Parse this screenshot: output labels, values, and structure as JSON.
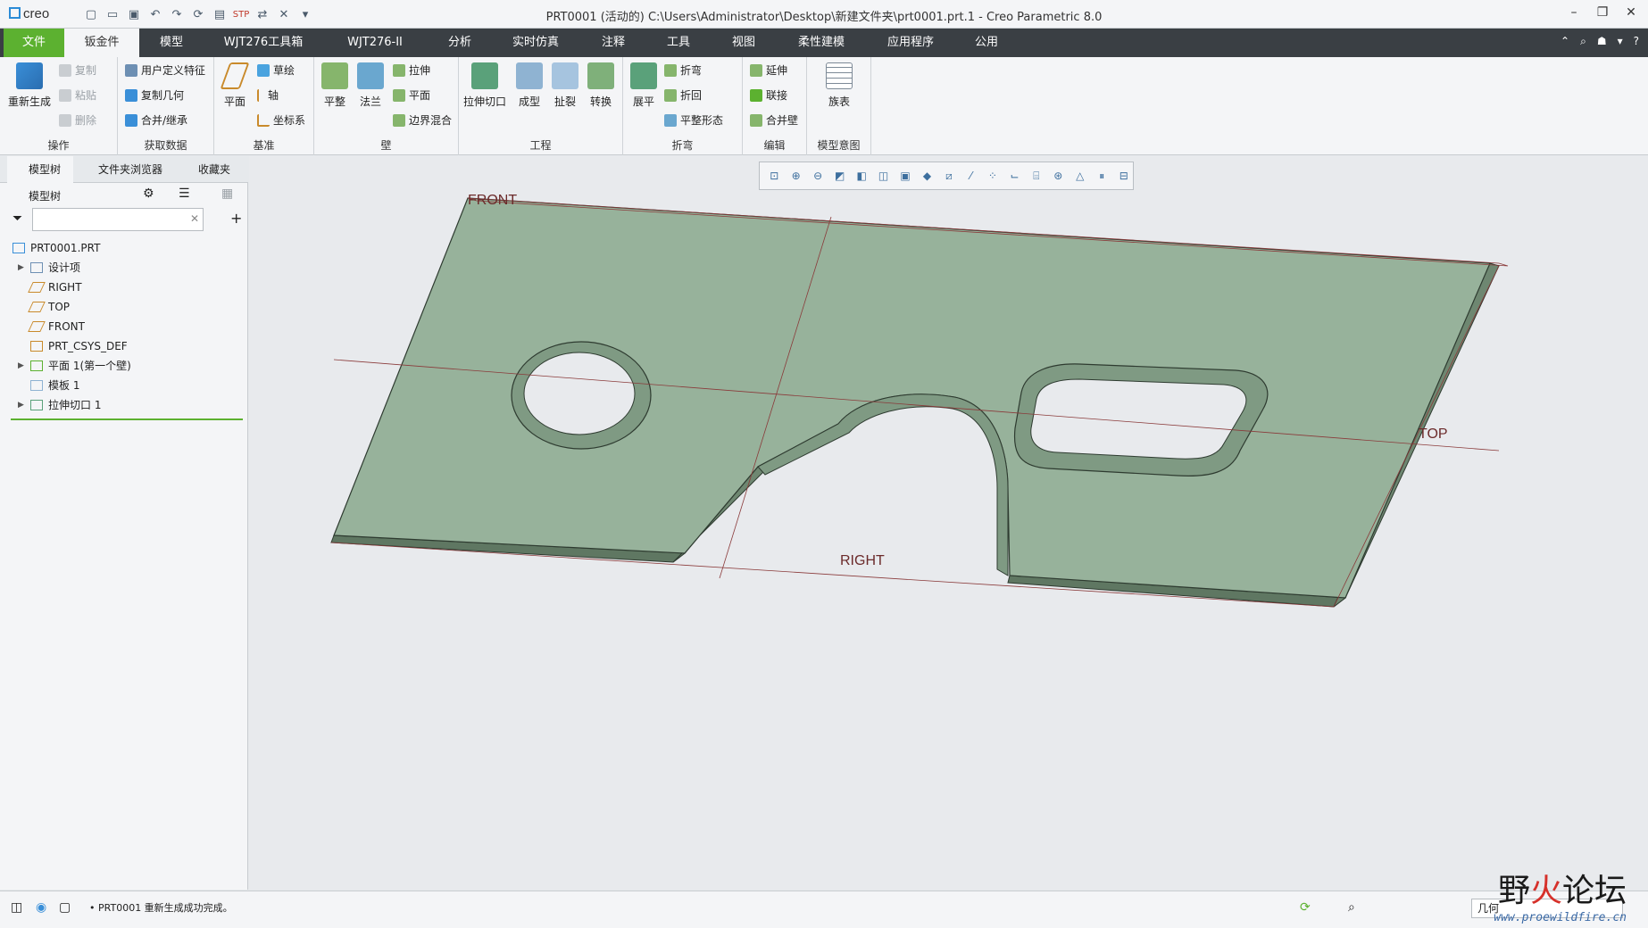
{
  "app": {
    "logo": "creo",
    "title": "PRT0001 (活动的) C:\\Users\\Administrator\\Desktop\\新建文件夹\\prt0001.prt.1 - Creo Parametric 8.0"
  },
  "qat_icons": [
    "new-icon",
    "open-icon",
    "save-icon",
    "undo-icon",
    "redo-icon",
    "regenerate-icon",
    "window-icon",
    "stp-icon",
    "switch-window-icon",
    "close-icon",
    "customize-icon"
  ],
  "menu": {
    "file": "文件",
    "sheetmetal": "钣金件",
    "model": "模型",
    "toolbox": "WJT276工具箱",
    "wjt2": "WJT276-II",
    "analysis": "分析",
    "simulation": "实时仿真",
    "annotate": "注释",
    "tools": "工具",
    "view": "视图",
    "flexible": "柔性建模",
    "apps": "应用程序",
    "common": "公用"
  },
  "ribbon": {
    "operations": {
      "label": "操作",
      "regenerate": "重新生成",
      "copy": "复制",
      "paste": "粘贴",
      "delete": "删除"
    },
    "getdata": {
      "label": "获取数据",
      "udf": "用户定义特征",
      "copygeom": "复制几何",
      "merge": "合并/继承"
    },
    "datum": {
      "label": "基准",
      "plane": "平面",
      "sketch": "草绘",
      "axis": "轴",
      "csys": "坐标系"
    },
    "wall": {
      "label": "壁",
      "flat": "平整",
      "flange": "法兰",
      "extrude": "拉伸",
      "planar": "平面",
      "blend": "边界混合"
    },
    "engineering": {
      "label": "工程",
      "extcut": "拉伸切口",
      "form": "成型",
      "rip": "扯裂",
      "convert": "转换"
    },
    "bends": {
      "label": "折弯",
      "unbend": "展平",
      "bend": "折弯",
      "bendback": "折回",
      "flatstate": "平整形态"
    },
    "editing": {
      "label": "编辑",
      "extend": "延伸",
      "join": "联接",
      "mergewall": "合并壁"
    },
    "intent": {
      "label": "模型意图",
      "family": "族表"
    }
  },
  "panel": {
    "tabs": {
      "model_tree": "模型树",
      "folder_browser": "文件夹浏览器",
      "favorites": "收藏夹"
    },
    "tree_title": "模型树",
    "tree": [
      {
        "label": "PRT0001.PRT",
        "icon": "part-icon",
        "expand": false,
        "indent": 0
      },
      {
        "label": "设计项",
        "icon": "design-items-icon",
        "expand": true,
        "indent": 1
      },
      {
        "label": "RIGHT",
        "icon": "datum-plane-icon",
        "expand": false,
        "indent": 1
      },
      {
        "label": "TOP",
        "icon": "datum-plane-icon",
        "expand": false,
        "indent": 1
      },
      {
        "label": "FRONT",
        "icon": "datum-plane-icon",
        "expand": false,
        "indent": 1
      },
      {
        "label": "PRT_CSYS_DEF",
        "icon": "csys-icon",
        "expand": false,
        "indent": 1
      },
      {
        "label": "平面 1(第一个壁)",
        "icon": "flat-wall-icon",
        "expand": true,
        "indent": 1
      },
      {
        "label": "模板 1",
        "icon": "form-icon",
        "expand": false,
        "indent": 1
      },
      {
        "label": "拉伸切口 1",
        "icon": "extrude-cut-icon",
        "expand": true,
        "indent": 1
      }
    ]
  },
  "viewport": {
    "front": "FRONT",
    "top": "TOP",
    "right": "RIGHT"
  },
  "status": {
    "message": "PRT0001 重新生成成功完成。",
    "filter": "几何"
  },
  "watermark": {
    "text_a": "野",
    "text_b": "火",
    "text_c": "论坛",
    "url": "www.proewildfire.cn"
  },
  "colors": {
    "accent_green": "#5cb130",
    "menubar": "#3a3f44",
    "part_face": "#97b29b"
  }
}
